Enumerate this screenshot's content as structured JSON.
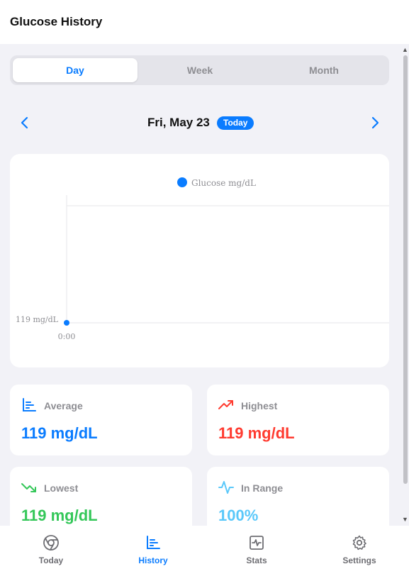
{
  "header": {
    "title": "Glucose History"
  },
  "segments": {
    "day": "Day",
    "week": "Week",
    "month": "Month",
    "active": "day"
  },
  "date_nav": {
    "date": "Fri, May 23",
    "badge": "Today"
  },
  "chart_data": {
    "type": "line",
    "legend": [
      "Glucose mg/dL"
    ],
    "series": [
      {
        "name": "Glucose mg/dL",
        "color": "#0a7cff",
        "points": [
          {
            "x": "0:00",
            "y": 119
          }
        ]
      }
    ],
    "x_tick_labels": [
      "0:00"
    ],
    "y_tick_labels": [
      "119 mg/dL"
    ],
    "grid": true,
    "legend_placement": "top"
  },
  "stats": {
    "average": {
      "label": "Average",
      "value": "119 mg/dL",
      "color": "#0a7cff",
      "icon": "bar-chart-icon"
    },
    "highest": {
      "label": "Highest",
      "value": "119 mg/dL",
      "color": "#ff3b30",
      "icon": "trending-up-icon"
    },
    "lowest": {
      "label": "Lowest",
      "value": "119 mg/dL",
      "color": "#34c759",
      "icon": "trending-down-icon"
    },
    "in_range": {
      "label": "In Range",
      "value": "100%",
      "color": "#5ac8fa",
      "icon": "pulse-icon"
    }
  },
  "tabbar": {
    "today": "Today",
    "history": "History",
    "stats": "Stats",
    "settings": "Settings",
    "active": "history"
  },
  "colors": {
    "accent": "#0a7cff",
    "background": "#f2f2f7"
  }
}
